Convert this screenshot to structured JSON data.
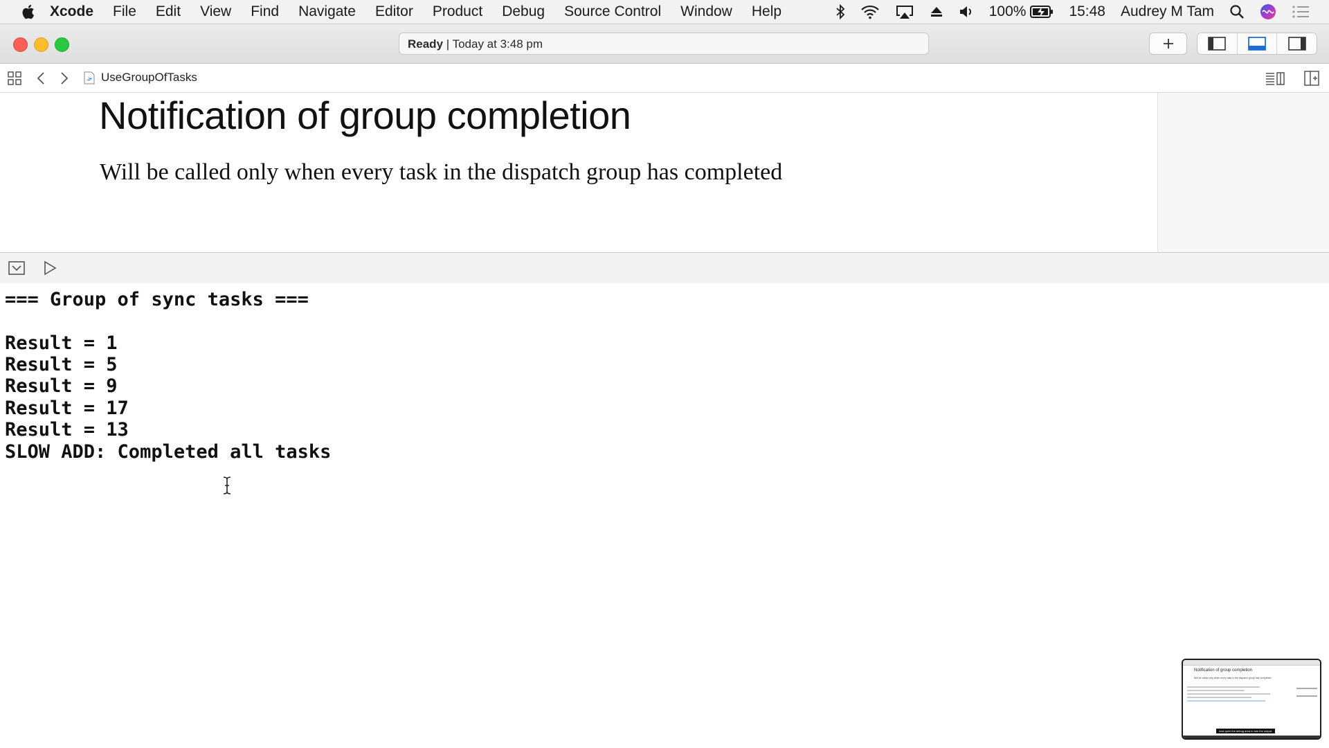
{
  "menubar": {
    "app_name": "Xcode",
    "items": [
      "File",
      "Edit",
      "View",
      "Find",
      "Navigate",
      "Editor",
      "Product",
      "Debug",
      "Source Control",
      "Window",
      "Help"
    ],
    "battery": "100%",
    "time": "15:48",
    "user": "Audrey M Tam"
  },
  "toolbar": {
    "activity_status": "Ready",
    "activity_detail": "Today at 3:48 pm"
  },
  "jumpbar": {
    "file_name": "UseGroupOfTasks"
  },
  "editor": {
    "title": "Notification of group completion",
    "subtitle": "Will be called only when every task in the dispatch group has completed"
  },
  "console": {
    "lines": [
      "=== Group of sync tasks ===",
      "",
      "Result = 1",
      "Result = 5",
      "Result = 9",
      "Result = 17",
      "Result = 13",
      "SLOW ADD: Completed all tasks"
    ]
  },
  "thumbnail": {
    "title": "Notification of group completion",
    "subtitle": "Will be called only when every task in the dispatch group has completed",
    "caption": "And open the debug area to see the output."
  },
  "colors": {
    "close": "#fe5f57",
    "minimize": "#febc2e",
    "zoom": "#28c840",
    "accent": "#1c6ed6"
  }
}
